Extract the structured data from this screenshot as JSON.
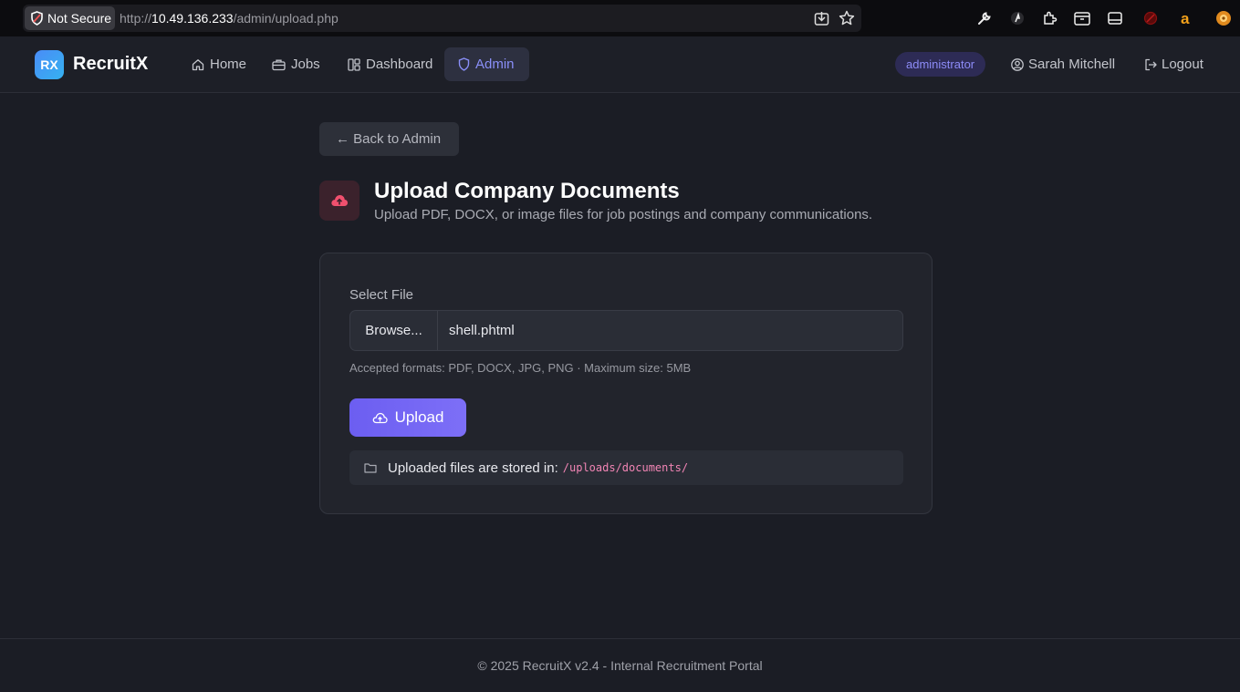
{
  "browser": {
    "security_label": "Not Secure",
    "url_scheme": "http://",
    "url_host": "10.49.136.233",
    "url_path": "/admin/upload.php",
    "toolbar_icons": [
      "install-icon",
      "bookmark-star-icon",
      "wrench-icon",
      "extension-arrow-icon",
      "puzzle-icon",
      "container-icon",
      "sidebar-icon",
      "blocker-icon",
      "amazon-icon",
      "avatar-icon"
    ]
  },
  "header": {
    "logo_mark": "RX",
    "app_name": "RecruitX",
    "nav": [
      {
        "label": "Home",
        "icon": "home-icon"
      },
      {
        "label": "Jobs",
        "icon": "briefcase-icon"
      },
      {
        "label": "Dashboard",
        "icon": "dashboard-icon"
      },
      {
        "label": "Admin",
        "icon": "shield-icon",
        "active": true
      }
    ],
    "role_badge": "administrator",
    "user_name": "Sarah Mitchell",
    "logout_label": "Logout"
  },
  "main": {
    "back_label": "← Back to Admin",
    "title": "Upload Company Documents",
    "subtitle": "Upload PDF, DOCX, or image files for job postings and company communications.",
    "form": {
      "field_label": "Select File",
      "browse_label": "Browse...",
      "file_name": "shell.phtml",
      "help_text": "Accepted formats: PDF, DOCX, JPG, PNG · Maximum size: 5MB",
      "upload_label": "Upload",
      "storage_text": "Uploaded files are stored in:",
      "storage_path": "/uploads/documents/"
    }
  },
  "footer": {
    "text": "© 2025 RecruitX v2.4 - Internal Recruitment Portal"
  },
  "colors": {
    "accent": "#6c5ef1",
    "background": "#1b1d25",
    "card": "#22242c",
    "danger_icon": "#f0506e",
    "path_pink": "#f285b5"
  }
}
